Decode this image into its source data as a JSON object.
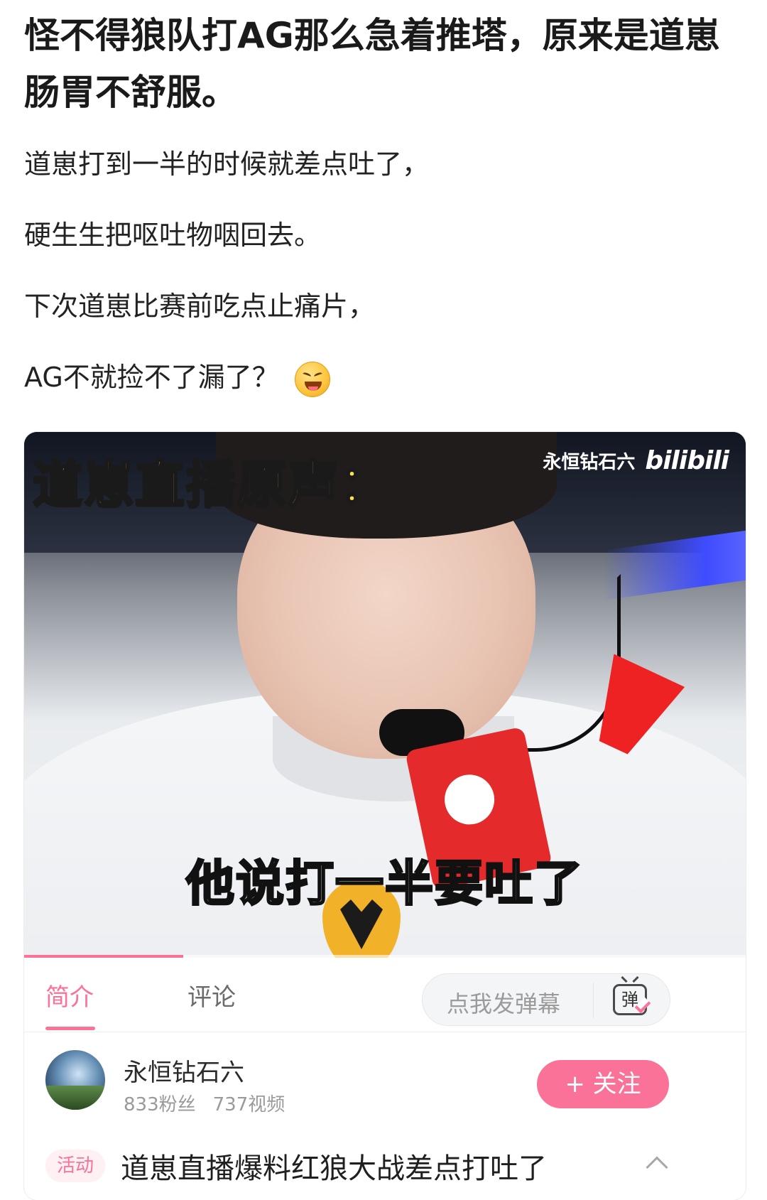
{
  "post": {
    "title": "怪不得狼队打AG那么急着推塔，原来是道崽肠胃不舒服。",
    "paragraphs": [
      "道崽打到一半的时候就差点吐了，",
      "硬生生把呕吐物咽回去。",
      "下次道崽比赛前吃点止痛片，",
      "AG不就捡不了漏了？"
    ],
    "emoji": "laughing-face-emoji"
  },
  "video": {
    "overlay_title": "道崽直播原声：",
    "watermark_author": "永恒钻石六",
    "watermark_brand": "bilibili",
    "subtitle": "他说打一半要吐了",
    "progress": 0.22,
    "accent_color": "#fb7299"
  },
  "tabs": {
    "intro": "简介",
    "comments": "评论",
    "danmaku_placeholder": "点我发弹幕",
    "danmaku_icon_text": "弹"
  },
  "uploader": {
    "name": "永恒钻石六",
    "fans": "833粉丝",
    "videos": "737视频",
    "follow_label": "+ 关注"
  },
  "activity": {
    "tag": "活动",
    "title": "道崽直播爆料红狼大战差点打吐了"
  }
}
